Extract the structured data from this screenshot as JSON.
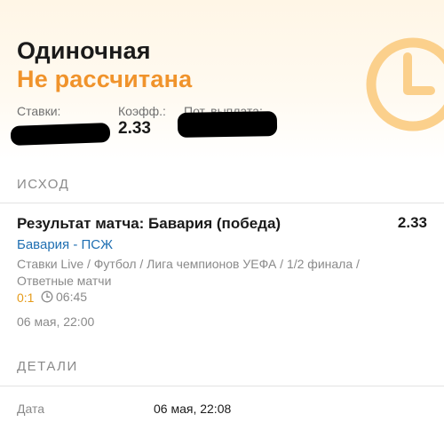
{
  "bet": {
    "type": "Одиночная",
    "status": "Не рассчитана",
    "stake_label": "Ставки:",
    "odds_label": "Коэфф.:",
    "odds_value": "2.33",
    "payout_label": "Пот. выплата:"
  },
  "outcome": {
    "section_title": "ИСХОД",
    "title": "Результат матча: Бавария (победа)",
    "odds": "2.33",
    "match": "Бавария - ПСЖ",
    "breadcrumb": "Ставки Live / Футбол / Лига чемпионов УЕФА / 1/2 финала / Ответные матчи",
    "score": "0:1",
    "time": "06:45",
    "date": "06 мая, 22:00"
  },
  "details": {
    "section_title": "ДЕТАЛИ",
    "date_label": "Дата",
    "date_value": "06 мая, 22:08"
  },
  "icons": {
    "header_decoration": "clock-icon",
    "time": "clock-icon"
  },
  "colors": {
    "status_accent": "#f0932b",
    "link": "#1f6fb2",
    "score": "#e59b1a"
  }
}
